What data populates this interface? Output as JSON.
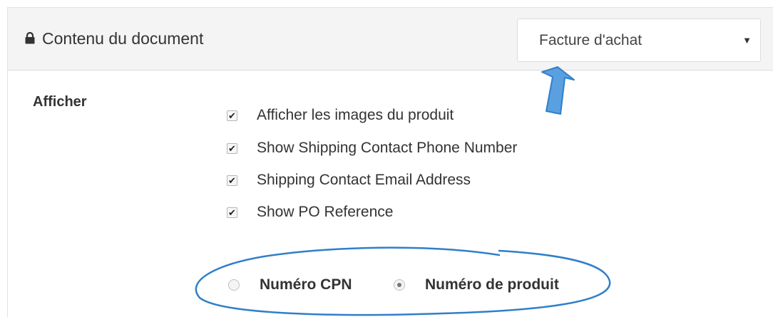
{
  "header": {
    "title": "Contenu du document",
    "lock_icon": "lock-icon",
    "select": {
      "value": "Facture d'achat",
      "caret": "▼"
    }
  },
  "display": {
    "label": "Afficher",
    "checkboxes": [
      {
        "label": "Afficher les images du produit",
        "checked": true
      },
      {
        "label": "Show Shipping Contact Phone Number",
        "checked": true
      },
      {
        "label": "Shipping Contact Email Address",
        "checked": true
      },
      {
        "label": "Show PO Reference",
        "checked": true
      }
    ],
    "check_mark": "✔",
    "radios": [
      {
        "label": "Numéro CPN",
        "checked": false
      },
      {
        "label": "Numéro de produit",
        "checked": true
      }
    ]
  },
  "colors": {
    "annotation": "#2f7fc9",
    "header_bg": "#f4f4f4"
  }
}
